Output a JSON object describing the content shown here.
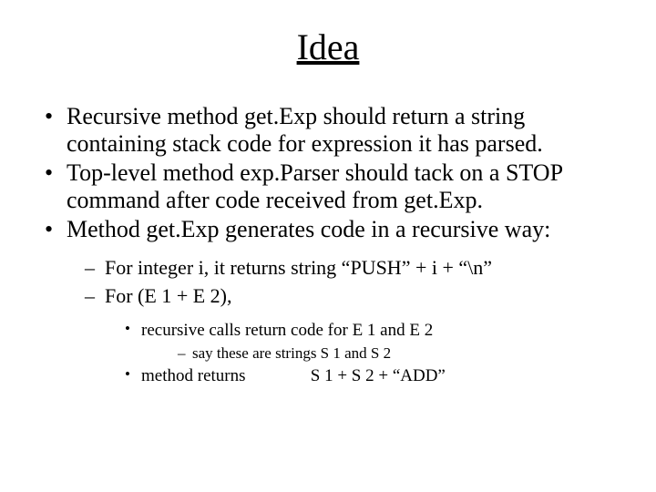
{
  "title": "Idea",
  "bullets": {
    "b1": "Recursive method get.Exp should return a string containing stack code for expression it has parsed.",
    "b2": "Top-level method exp.Parser should tack on a STOP command after code received from get.Exp.",
    "b3": "Method get.Exp generates code in a recursive way:"
  },
  "sub": {
    "s1": "For integer i, it returns string “PUSH” + i + “\\n”",
    "s2": "For (E 1 + E 2),"
  },
  "subsub": {
    "t1": "recursive calls return code for E 1 and E 2",
    "t2": "method returns               S 1 + S 2 + “ADD”"
  },
  "deep": {
    "d1": "say these are strings S 1 and S 2"
  }
}
